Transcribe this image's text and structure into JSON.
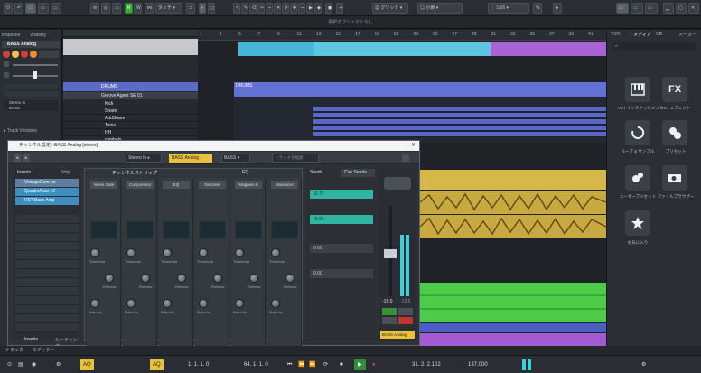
{
  "toolbar": {
    "mode_r": "R",
    "mode_w": "W",
    "mode_a": "A",
    "touch_label": "タッチ",
    "grid_label": "グリッド",
    "quantize_label": "小節",
    "quantize_value": "1/16",
    "info_line": "選択オブジェクトなし"
  },
  "inspector": {
    "tab_inspector": "Inspector",
    "tab_visibility": "Visibility",
    "track_name": "BASS Analog",
    "stereo_in": "Stereo In",
    "bass": "BASS",
    "track_versions": "Track Versions"
  },
  "tracks": {
    "folder_name": "DRUMS",
    "groove_agent": "Groove Agent SE 01",
    "items": [
      "Kick",
      "Snare",
      "AddSnare",
      "Toms",
      "HH",
      "cymbals"
    ]
  },
  "ruler": {
    "bars": [
      "1",
      "3",
      "5",
      "7",
      "9",
      "11",
      "13",
      "15",
      "17",
      "19",
      "21",
      "23",
      "25",
      "27",
      "29",
      "31",
      "33",
      "35",
      "37",
      "39",
      "41"
    ]
  },
  "arranger": {
    "drums_clip_label": "DRUMS"
  },
  "channel_window": {
    "title": "チャンネル設定 : BASS Analog [stereo]",
    "input": "Stereo In",
    "track": "BASS Analog",
    "output": "BASS",
    "search_placeholder": "トラックを検索",
    "inserts_label": "Inserts",
    "strip_label": "Strip",
    "inserts": [
      "VintageCom..or",
      "QuadraFuzz v2",
      "VST Bass Amp"
    ],
    "channel_strip_header": "チャンネルストリップ",
    "eq_header": "EQ",
    "sends_label": "Sends",
    "cue_sends_label": "Cue Sends",
    "strip_modules": [
      "Noise Gate",
      "Compressor",
      "EQ",
      "DeEsser",
      "Magneto II",
      "Maximizer"
    ],
    "knob_labels": {
      "threshold": "Threshold",
      "range": "Range",
      "ratio": "Ratio",
      "attack": "Attack",
      "release": "Release",
      "makeup": "MakeUp",
      "saturation": "Saturation",
      "hf_adjust": "HF-Adjust",
      "output": "Output",
      "mix": "Mix",
      "freq": "Freq",
      "sc": "SC"
    },
    "eq_values": [
      "-0.72",
      "-0.06"
    ],
    "sends_values": [
      "0.00",
      "0.00"
    ],
    "fader_value": "-15.0",
    "fader_peak": "-13.6",
    "channel_name": "BASS Analog",
    "bottom_tabs": [
      "Inserts",
      "ルーティング"
    ]
  },
  "mediabay": {
    "tabs": [
      "VSTi",
      "メディア",
      "CR",
      "メーター"
    ],
    "items": [
      "VST インストゥルメント",
      "VST エフェクト",
      "ループ & サンプル",
      "プリセット",
      "ユーザープリセット",
      "ファイルブラウザー",
      "お気に入り"
    ]
  },
  "footer": {
    "tab_track": "トラック",
    "tab_editor": "エディター"
  },
  "transport": {
    "left_locator": "1. 1. 1. 0",
    "right_locator": "64. 1. 1. 0",
    "position": "31. 2. 2.102",
    "tempo": "137.000",
    "aq": "AQ"
  },
  "colors": {
    "accent_yellow": "#e9c23c",
    "clip_blue": "#5566c9",
    "clip_cyan": "#3fb3d8",
    "clip_purple": "#a85bd4",
    "clip_green": "#4ec94a",
    "clip_orange": "#c98a2b"
  }
}
